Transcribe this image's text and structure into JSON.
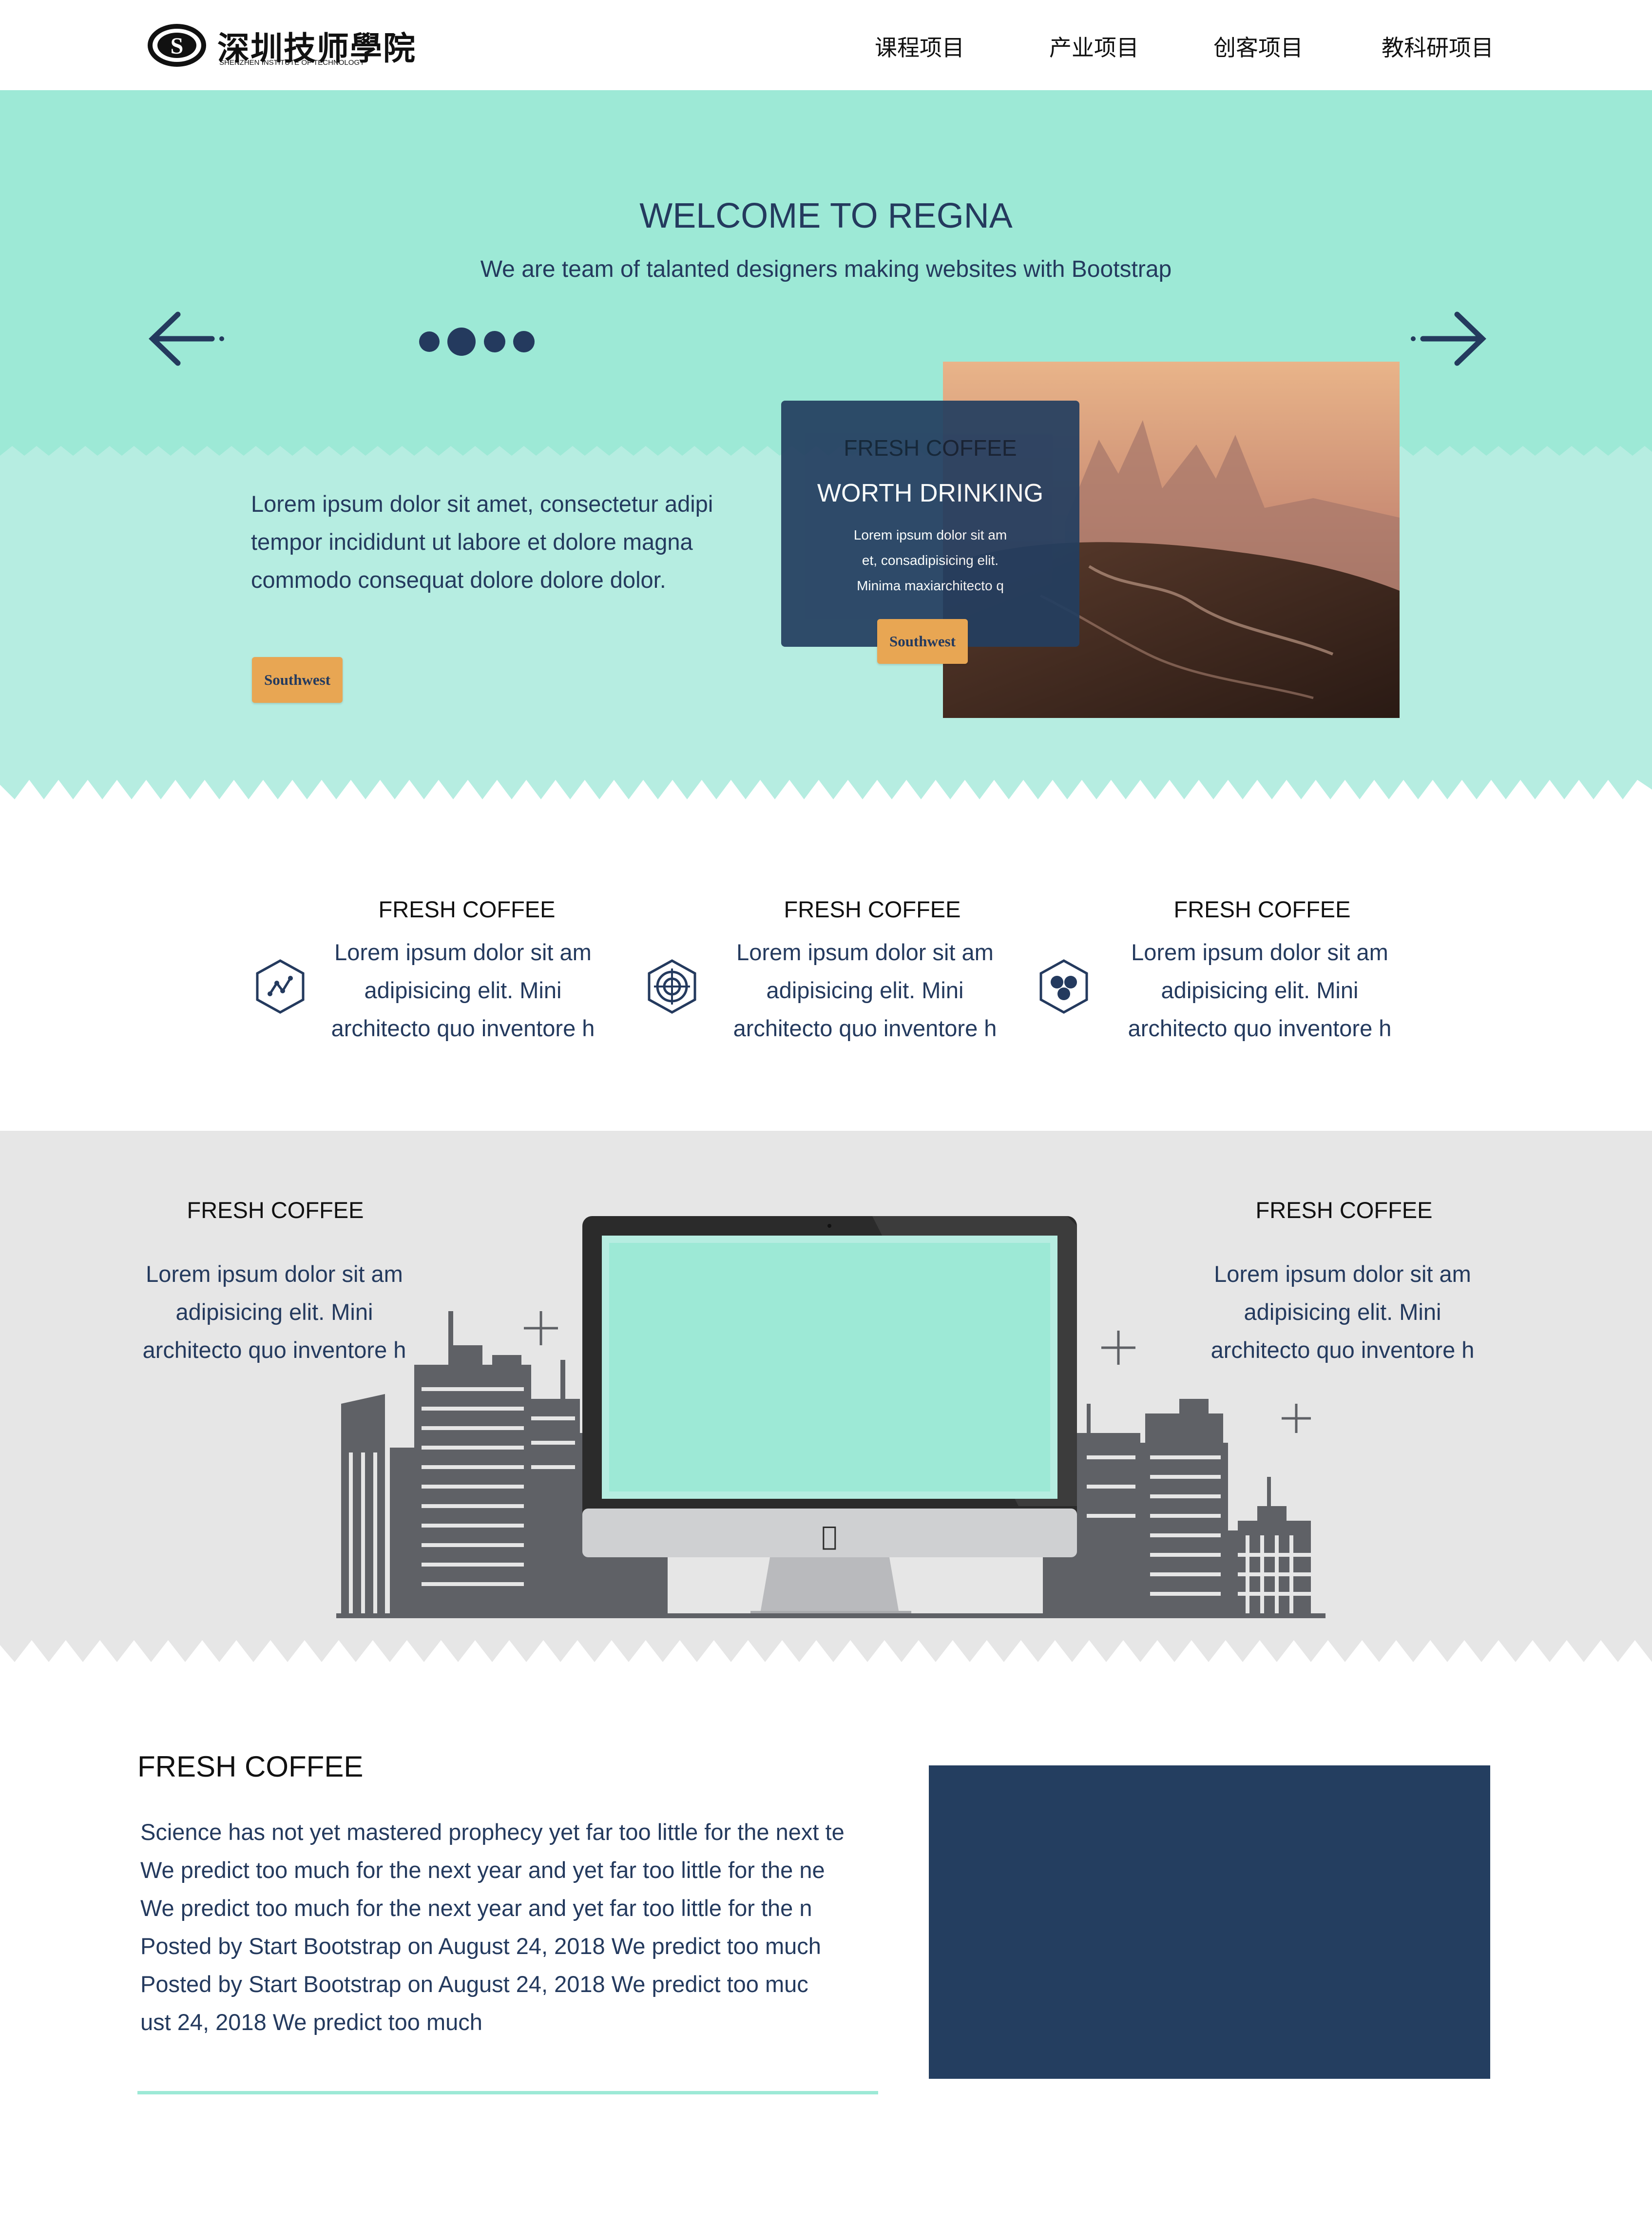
{
  "nav": {
    "logo_cn": "深圳技师學院",
    "logo_en": "SHENZHEN INSTITUTE OF TECHNOLOGY",
    "items": [
      "课程项目",
      "产业项目",
      "创客项目",
      "教科研项目"
    ]
  },
  "hero": {
    "title": "WELCOME TO REGNA",
    "subtitle": "We are team of talanted designers making websites with Bootstrap",
    "text_lines": [
      "Lorem ipsum dolor sit amet, consectetur adipi",
      "tempor incididunt ut labore et dolore magna",
      "commodo consequat dolore  dolore  dolor."
    ],
    "button_label": "Southwest",
    "card": {
      "title1": "FRESH COFFEE",
      "title2": "WORTH DRINKING",
      "lines": [
        "Lorem ipsum dolor sit am",
        "et, consadipisicing elit.",
        "Minima maxiarchitecto q"
      ],
      "button_label": "Southwest"
    }
  },
  "features": [
    {
      "title": "FRESH COFFEE",
      "icon": "chart-hex-icon",
      "lines": [
        "Lorem ipsum dolor sit am",
        "adipisicing elit. Mini",
        "architecto quo inventore h"
      ]
    },
    {
      "title": "FRESH COFFEE",
      "icon": "target-hex-icon",
      "lines": [
        "Lorem ipsum dolor sit am",
        "adipisicing elit. Mini",
        "architecto quo inventore h"
      ]
    },
    {
      "title": "FRESH COFFEE",
      "icon": "molecule-hex-icon",
      "lines": [
        "Lorem ipsum dolor sit am",
        "adipisicing elit. Mini",
        "architecto quo inventore h"
      ]
    }
  ],
  "showcase": {
    "left": {
      "title": "FRESH COFFEE",
      "lines": [
        "Lorem ipsum dolor sit am",
        "adipisicing elit. Mini",
        "architecto quo inventore h"
      ]
    },
    "right": {
      "title": "FRESH COFFEE",
      "lines": [
        "Lorem ipsum dolor sit am",
        "adipisicing elit. Mini",
        "architecto quo inventore h"
      ]
    }
  },
  "blog": {
    "title": "FRESH COFFEE",
    "lines": [
      "Science has not yet mastered prophecy yet far too little for the next te",
      "We predict too much for the next year and yet far too little for the ne",
      "We predict too much for the next year and yet far too little for the n",
      "Posted by Start Bootstrap on August 24, 2018 We predict too much",
      "Posted by Start Bootstrap on August 24, 2018 We predict too muc",
      "ust 24, 2018 We predict too much"
    ]
  },
  "colors": {
    "mint": "#9de9d6",
    "mint_light": "#b6ede1",
    "navy": "#243e60",
    "orange": "#e8a653",
    "gray": "#e6e6e6"
  }
}
